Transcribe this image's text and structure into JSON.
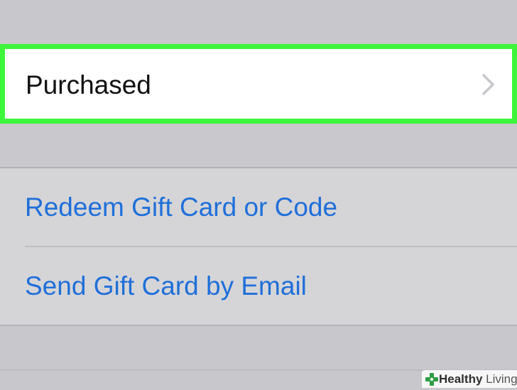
{
  "purchased_row": {
    "label": "Purchased",
    "chevron_icon": "chevron-right-icon",
    "highlight_color": "#3df53b"
  },
  "actions": [
    {
      "label": "Redeem Gift Card or Code"
    },
    {
      "label": "Send Gift Card by Email"
    }
  ],
  "link_color": "#1f6fd9",
  "watermark": {
    "brand_bold": "Healthy",
    "brand_light": " Living",
    "icon": "healthy-living-logo-icon"
  }
}
